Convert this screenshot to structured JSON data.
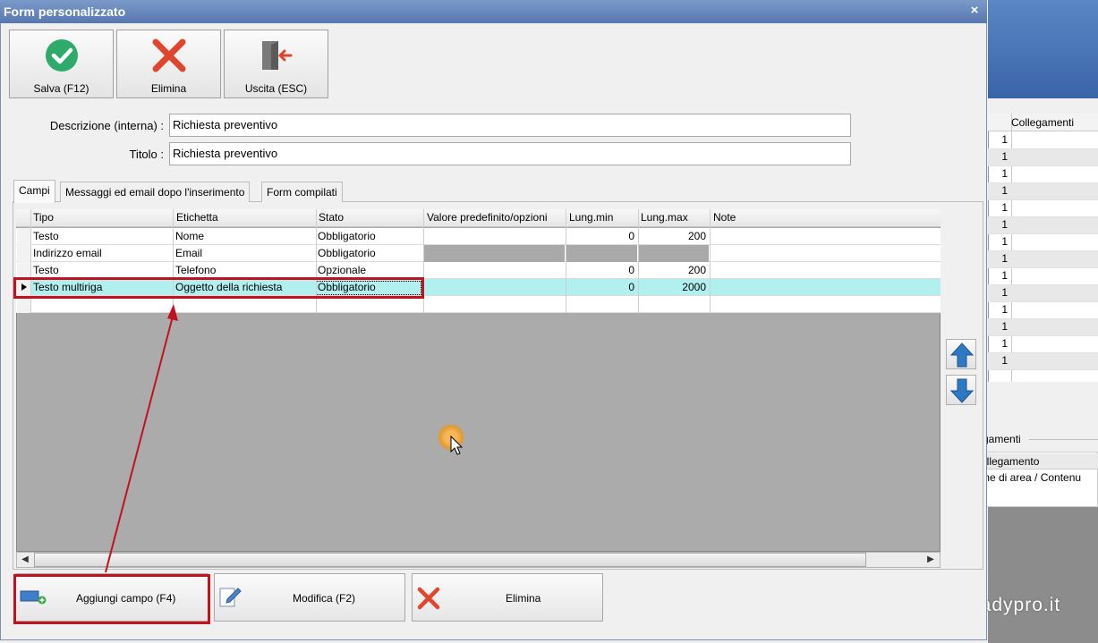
{
  "dialog": {
    "title": "Form personalizzato",
    "close_glyph": "×"
  },
  "toolbar": {
    "save_label": "Salva (F12)",
    "delete_label": "Elimina",
    "exit_label": "Uscita (ESC)"
  },
  "form": {
    "description_label": "Descrizione (interna) :",
    "description_value": "Richiesta preventivo",
    "title_label": "Titolo :",
    "title_value": "Richiesta preventivo"
  },
  "tabs": [
    {
      "label": "Campi"
    },
    {
      "label": "Messaggi ed email dopo l'inserimento"
    },
    {
      "label": "Form compilati"
    }
  ],
  "grid": {
    "columns": [
      "Tipo",
      "Etichetta",
      "Stato",
      "Valore predefinito/opzioni",
      "Lung.min",
      "Lung.max",
      "Note"
    ],
    "rows": [
      {
        "tipo": "Testo",
        "etichetta": "Nome",
        "stato": "Obbligatorio",
        "valore": "",
        "min": "0",
        "max": "200",
        "note": ""
      },
      {
        "tipo": "Indirizzo email",
        "etichetta": "Email",
        "stato": "Obbligatorio",
        "valore": "",
        "min": "",
        "max": "",
        "note": ""
      },
      {
        "tipo": "Testo",
        "etichetta": "Telefono",
        "stato": "Opzionale",
        "valore": "",
        "min": "0",
        "max": "200",
        "note": ""
      },
      {
        "tipo": "Testo multiriga",
        "etichetta": "Oggetto della richiesta",
        "stato": "Obbligatorio",
        "valore": "",
        "min": "0",
        "max": "2000",
        "note": ""
      }
    ]
  },
  "bottom_buttons": {
    "add_label": "Aggiungi campo (F4)",
    "edit_label": "Modifica (F2)",
    "delete_label": "Elimina"
  },
  "background_window": {
    "column_header": "Collegamenti",
    "row_values": [
      "1",
      "1",
      "1",
      "1",
      "1",
      "1",
      "1",
      "1",
      "1",
      "1",
      "1",
      "1",
      "1",
      "1"
    ],
    "group_label": "gamenti",
    "link_header": "ollegamento",
    "area_text": "me di area / Contenu"
  },
  "watermark": "readypro.it",
  "colors": {
    "selection": "#b2f0f0",
    "annotation_red": "#c1121f",
    "title_bar": "#5777b0"
  }
}
